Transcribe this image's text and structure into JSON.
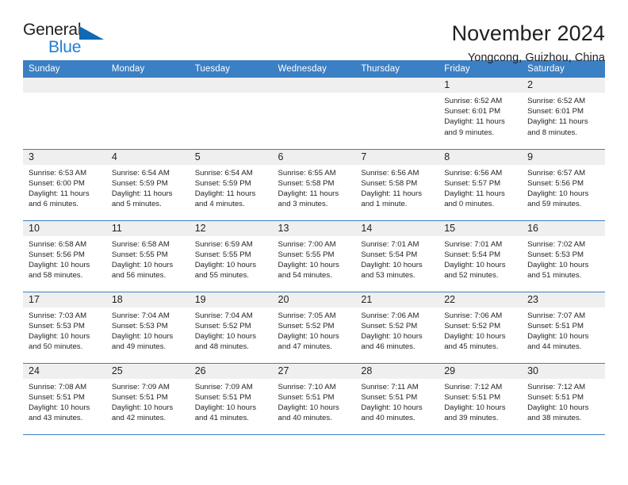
{
  "brand": {
    "word_one": "General",
    "word_two": "Blue",
    "triangle_color": "#1168b3",
    "blue_color": "#1e7fd4"
  },
  "header": {
    "title": "November 2024",
    "location": "Yongcong, Guizhou, China"
  },
  "theme": {
    "header_bg": "#3b7fc4",
    "header_text": "#ffffff",
    "daynum_bg": "#efefef",
    "body_text": "#231f20",
    "row_border": "#3b7fc4"
  },
  "weekdays": [
    "Sunday",
    "Monday",
    "Tuesday",
    "Wednesday",
    "Thursday",
    "Friday",
    "Saturday"
  ],
  "labels": {
    "sunrise": "Sunrise:",
    "sunset": "Sunset:",
    "daylight": "Daylight:"
  },
  "weeks": [
    [
      {
        "day": "",
        "empty": true
      },
      {
        "day": "",
        "empty": true
      },
      {
        "day": "",
        "empty": true
      },
      {
        "day": "",
        "empty": true
      },
      {
        "day": "",
        "empty": true
      },
      {
        "day": "1",
        "sunrise": "Sunrise: 6:52 AM",
        "sunset": "Sunset: 6:01 PM",
        "daylight": "Daylight: 11 hours and 9 minutes."
      },
      {
        "day": "2",
        "sunrise": "Sunrise: 6:52 AM",
        "sunset": "Sunset: 6:01 PM",
        "daylight": "Daylight: 11 hours and 8 minutes."
      }
    ],
    [
      {
        "day": "3",
        "sunrise": "Sunrise: 6:53 AM",
        "sunset": "Sunset: 6:00 PM",
        "daylight": "Daylight: 11 hours and 6 minutes."
      },
      {
        "day": "4",
        "sunrise": "Sunrise: 6:54 AM",
        "sunset": "Sunset: 5:59 PM",
        "daylight": "Daylight: 11 hours and 5 minutes."
      },
      {
        "day": "5",
        "sunrise": "Sunrise: 6:54 AM",
        "sunset": "Sunset: 5:59 PM",
        "daylight": "Daylight: 11 hours and 4 minutes."
      },
      {
        "day": "6",
        "sunrise": "Sunrise: 6:55 AM",
        "sunset": "Sunset: 5:58 PM",
        "daylight": "Daylight: 11 hours and 3 minutes."
      },
      {
        "day": "7",
        "sunrise": "Sunrise: 6:56 AM",
        "sunset": "Sunset: 5:58 PM",
        "daylight": "Daylight: 11 hours and 1 minute."
      },
      {
        "day": "8",
        "sunrise": "Sunrise: 6:56 AM",
        "sunset": "Sunset: 5:57 PM",
        "daylight": "Daylight: 11 hours and 0 minutes."
      },
      {
        "day": "9",
        "sunrise": "Sunrise: 6:57 AM",
        "sunset": "Sunset: 5:56 PM",
        "daylight": "Daylight: 10 hours and 59 minutes."
      }
    ],
    [
      {
        "day": "10",
        "sunrise": "Sunrise: 6:58 AM",
        "sunset": "Sunset: 5:56 PM",
        "daylight": "Daylight: 10 hours and 58 minutes."
      },
      {
        "day": "11",
        "sunrise": "Sunrise: 6:58 AM",
        "sunset": "Sunset: 5:55 PM",
        "daylight": "Daylight: 10 hours and 56 minutes."
      },
      {
        "day": "12",
        "sunrise": "Sunrise: 6:59 AM",
        "sunset": "Sunset: 5:55 PM",
        "daylight": "Daylight: 10 hours and 55 minutes."
      },
      {
        "day": "13",
        "sunrise": "Sunrise: 7:00 AM",
        "sunset": "Sunset: 5:55 PM",
        "daylight": "Daylight: 10 hours and 54 minutes."
      },
      {
        "day": "14",
        "sunrise": "Sunrise: 7:01 AM",
        "sunset": "Sunset: 5:54 PM",
        "daylight": "Daylight: 10 hours and 53 minutes."
      },
      {
        "day": "15",
        "sunrise": "Sunrise: 7:01 AM",
        "sunset": "Sunset: 5:54 PM",
        "daylight": "Daylight: 10 hours and 52 minutes."
      },
      {
        "day": "16",
        "sunrise": "Sunrise: 7:02 AM",
        "sunset": "Sunset: 5:53 PM",
        "daylight": "Daylight: 10 hours and 51 minutes."
      }
    ],
    [
      {
        "day": "17",
        "sunrise": "Sunrise: 7:03 AM",
        "sunset": "Sunset: 5:53 PM",
        "daylight": "Daylight: 10 hours and 50 minutes."
      },
      {
        "day": "18",
        "sunrise": "Sunrise: 7:04 AM",
        "sunset": "Sunset: 5:53 PM",
        "daylight": "Daylight: 10 hours and 49 minutes."
      },
      {
        "day": "19",
        "sunrise": "Sunrise: 7:04 AM",
        "sunset": "Sunset: 5:52 PM",
        "daylight": "Daylight: 10 hours and 48 minutes."
      },
      {
        "day": "20",
        "sunrise": "Sunrise: 7:05 AM",
        "sunset": "Sunset: 5:52 PM",
        "daylight": "Daylight: 10 hours and 47 minutes."
      },
      {
        "day": "21",
        "sunrise": "Sunrise: 7:06 AM",
        "sunset": "Sunset: 5:52 PM",
        "daylight": "Daylight: 10 hours and 46 minutes."
      },
      {
        "day": "22",
        "sunrise": "Sunrise: 7:06 AM",
        "sunset": "Sunset: 5:52 PM",
        "daylight": "Daylight: 10 hours and 45 minutes."
      },
      {
        "day": "23",
        "sunrise": "Sunrise: 7:07 AM",
        "sunset": "Sunset: 5:51 PM",
        "daylight": "Daylight: 10 hours and 44 minutes."
      }
    ],
    [
      {
        "day": "24",
        "sunrise": "Sunrise: 7:08 AM",
        "sunset": "Sunset: 5:51 PM",
        "daylight": "Daylight: 10 hours and 43 minutes."
      },
      {
        "day": "25",
        "sunrise": "Sunrise: 7:09 AM",
        "sunset": "Sunset: 5:51 PM",
        "daylight": "Daylight: 10 hours and 42 minutes."
      },
      {
        "day": "26",
        "sunrise": "Sunrise: 7:09 AM",
        "sunset": "Sunset: 5:51 PM",
        "daylight": "Daylight: 10 hours and 41 minutes."
      },
      {
        "day": "27",
        "sunrise": "Sunrise: 7:10 AM",
        "sunset": "Sunset: 5:51 PM",
        "daylight": "Daylight: 10 hours and 40 minutes."
      },
      {
        "day": "28",
        "sunrise": "Sunrise: 7:11 AM",
        "sunset": "Sunset: 5:51 PM",
        "daylight": "Daylight: 10 hours and 40 minutes."
      },
      {
        "day": "29",
        "sunrise": "Sunrise: 7:12 AM",
        "sunset": "Sunset: 5:51 PM",
        "daylight": "Daylight: 10 hours and 39 minutes."
      },
      {
        "day": "30",
        "sunrise": "Sunrise: 7:12 AM",
        "sunset": "Sunset: 5:51 PM",
        "daylight": "Daylight: 10 hours and 38 minutes."
      }
    ]
  ]
}
